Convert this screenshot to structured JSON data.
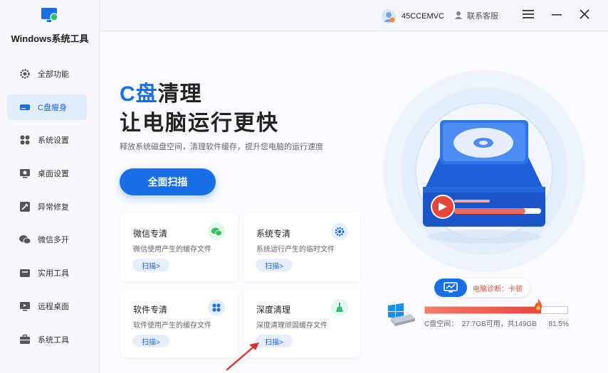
{
  "app": {
    "name": "Windows系统工具"
  },
  "sidebar": {
    "items": [
      {
        "label": "全部功能",
        "icon": "gear-icon"
      },
      {
        "label": "C盘瘦身",
        "icon": "drive-icon",
        "active": true
      },
      {
        "label": "系统设置",
        "icon": "grid-icon"
      },
      {
        "label": "桌面设置",
        "icon": "monitor-icon"
      },
      {
        "label": "异常修复",
        "icon": "wrench-icon"
      },
      {
        "label": "微信多开",
        "icon": "wechat-icon"
      },
      {
        "label": "实用工具",
        "icon": "toolbox-icon"
      },
      {
        "label": "远程桌面",
        "icon": "remote-icon"
      },
      {
        "label": "系统工具",
        "icon": "briefcase-icon"
      }
    ]
  },
  "topbar": {
    "username": "45CCEMVC",
    "service_label": "联系客服"
  },
  "hero": {
    "title_accent": "C盘",
    "title_rest": "清理",
    "subtitle": "让电脑运行更快",
    "description": "释放系统磁盘空间，清理软件缓存，提升您电脑的运行速度",
    "scan_button": "全面扫描"
  },
  "cards": [
    {
      "title": "微信专清",
      "desc": "微信使用产生的缓存文件",
      "button": "扫描>",
      "icon": "wechat-icon"
    },
    {
      "title": "系统专清",
      "desc": "系统运行产生的临时文件",
      "button": "扫描>",
      "icon": "gear-icon"
    },
    {
      "title": "软件专清",
      "desc": "软件使用产生的缓存文件",
      "button": "扫描>",
      "icon": "apps-icon"
    },
    {
      "title": "深度清理",
      "desc": "深度清理顽固缓存文件",
      "button": "扫描>",
      "icon": "broom-icon"
    }
  ],
  "diagnosis": {
    "text": "电脑诊断：卡顿"
  },
  "disk": {
    "text": "C盘空间：  27.7GB可用，共149GB      81.5%",
    "used_percent": 81.5
  },
  "colors": {
    "accent": "#1a6fe8",
    "danger": "#e8483c"
  }
}
